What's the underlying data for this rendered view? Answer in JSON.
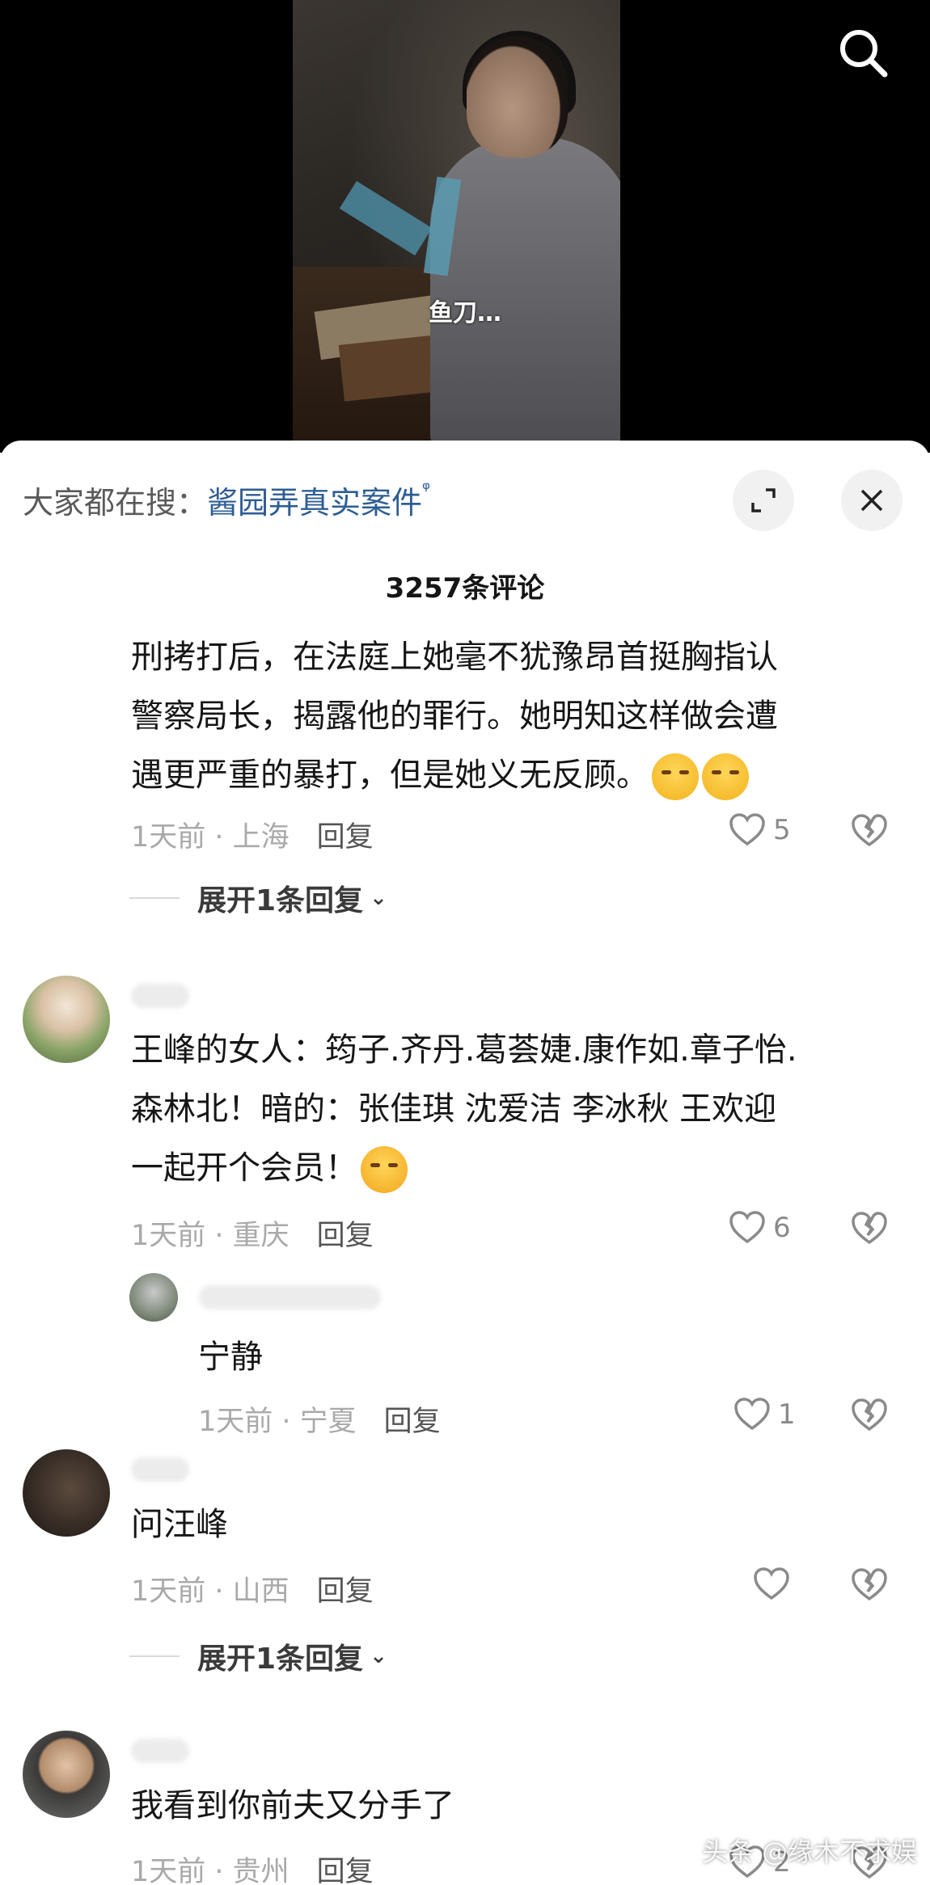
{
  "video": {
    "subtitle": "鱼刀…"
  },
  "search_bar": {
    "prefix": "大家都在搜：",
    "query": "酱园弄真实案件"
  },
  "comment_count": "3257条评论",
  "comments": [
    {
      "lines": [
        "刑拷打后，在法庭上她毫不犹豫昂首挺胸指认",
        "警察局长，揭露他的罪行。她明知这样做会遭",
        "遇更严重的暴打，但是她义无反顾。"
      ],
      "time_location": "1天前 · 上海",
      "reply_label": "回复",
      "likes": "5",
      "expand": "展开1条回复"
    },
    {
      "lines": [
        "王峰的女人：筠子.齐丹.葛荟婕.康作如.章子怡.",
        "森林北！暗的：张佳琪 沈爱洁  李冰秋  王欢迎",
        "一起开个会员！"
      ],
      "time_location": "1天前 · 重庆",
      "reply_label": "回复",
      "likes": "6"
    },
    {
      "lines": [
        "宁静"
      ],
      "time_location": "1天前 · 宁夏",
      "reply_label": "回复",
      "likes": "1"
    },
    {
      "lines": [
        "问汪峰"
      ],
      "time_location": "1天前 · 山西",
      "reply_label": "回复",
      "likes": "",
      "expand": "展开1条回复"
    },
    {
      "lines": [
        "我看到你前夫又分手了"
      ],
      "time_location": "1天前 · 贵州",
      "reply_label": "回复",
      "likes": "2"
    }
  ],
  "watermark": "头条 @缘木不求娱",
  "colors": {
    "link": "#2d5d93",
    "meta": "#a9a9a9",
    "panel_bg": "#ffffff"
  }
}
